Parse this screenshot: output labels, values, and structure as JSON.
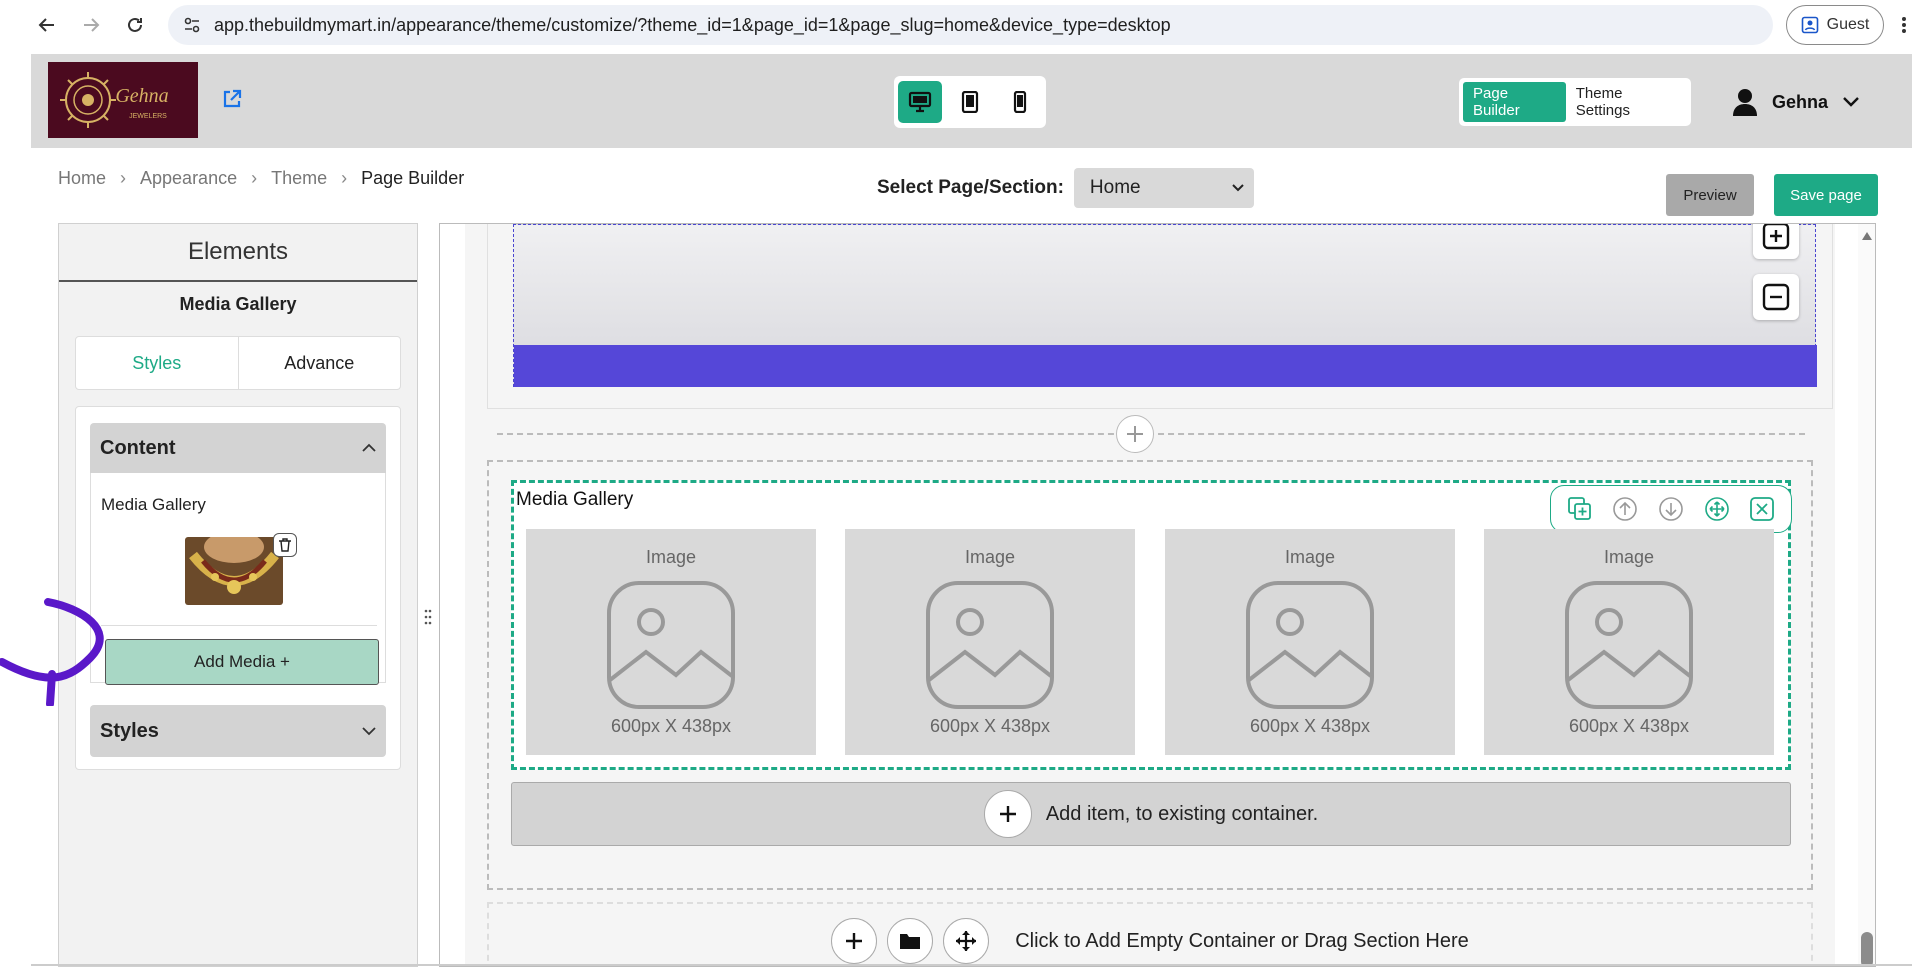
{
  "browser": {
    "url": "app.thebuildmymart.in/appearance/theme/customize/?theme_id=1&page_id=1&page_slug=home&device_type=desktop",
    "profile_label": "Guest"
  },
  "header": {
    "logo_text": "Gehna",
    "logo_subtext": "JEWELERS",
    "modes": [
      "Page Builder",
      "Theme Settings"
    ],
    "user_name": "Gehna"
  },
  "breadcrumb": [
    "Home",
    "Appearance",
    "Theme",
    "Page Builder"
  ],
  "page_select": {
    "label": "Select Page/Section:",
    "value": "Home"
  },
  "actions": {
    "preview": "Preview",
    "save": "Save page"
  },
  "left_panel": {
    "title": "Elements",
    "subtitle": "Media Gallery",
    "tabs": [
      "Styles",
      "Advance"
    ],
    "content_head": "Content",
    "content_label": "Media Gallery",
    "add_media": "Add Media +",
    "styles_head": "Styles"
  },
  "canvas": {
    "gallery_title": "Media Gallery",
    "gallery_items": [
      {
        "label": "Image",
        "size": "600px X 438px"
      },
      {
        "label": "Image",
        "size": "600px X 438px"
      },
      {
        "label": "Image",
        "size": "600px X 438px"
      },
      {
        "label": "Image",
        "size": "600px X 438px"
      }
    ],
    "add_item": "Add item, to existing container.",
    "empty_container": "Click to Add Empty Container or Drag Section Here"
  },
  "colors": {
    "accent": "#1eaa86",
    "hero_bar": "#5547d8",
    "logo_bg": "#4b0a1f"
  }
}
